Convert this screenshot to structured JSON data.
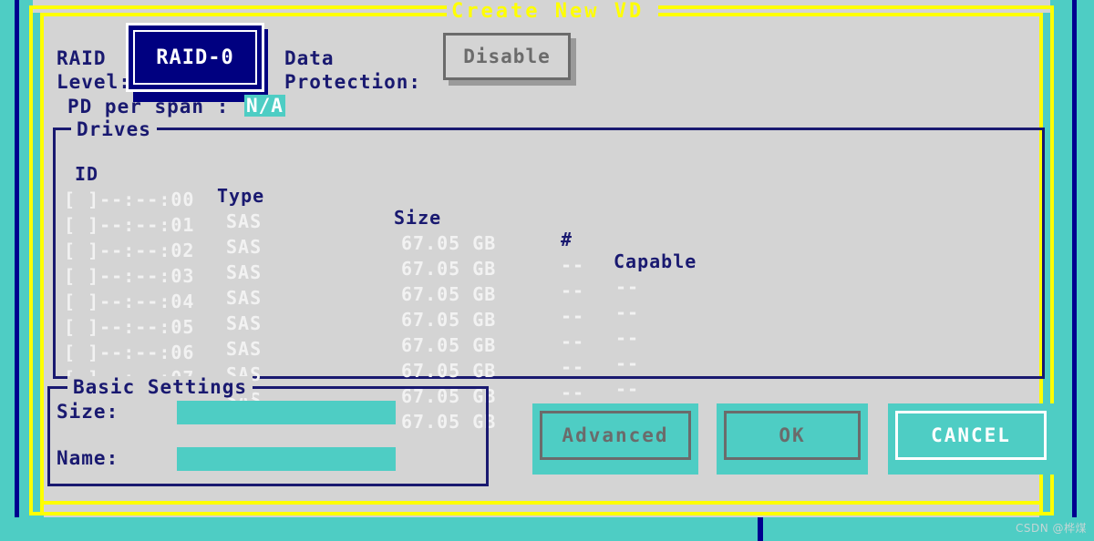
{
  "window": {
    "title": "Create New VD",
    "title_color": "#ffff00",
    "frame_color": "#00008f",
    "surface_color": "#d4d4d4",
    "accent_teal": "#4ecdc4",
    "navy_text_color": "#191970"
  },
  "raid": {
    "label_line1": "RAID",
    "label_line2": "Level:",
    "selected_level": "RAID-0",
    "pd_per_span_label": "PD per span :",
    "pd_per_span_value": "N/A"
  },
  "data_protection": {
    "label_line1": "Data",
    "label_line2": "Protection:",
    "value": "Disable"
  },
  "drives": {
    "legend": "Drives",
    "columns": [
      "ID",
      "Type",
      "Size",
      "#",
      "Capable"
    ],
    "rows": [
      {
        "id": "[ ]--:--:00",
        "type": "SAS",
        "size": "67.05 GB",
        "num": "--",
        "capable": "--"
      },
      {
        "id": "[ ]--:--:01",
        "type": "SAS",
        "size": "67.05 GB",
        "num": "--",
        "capable": "--"
      },
      {
        "id": "[ ]--:--:02",
        "type": "SAS",
        "size": "67.05 GB",
        "num": "--",
        "capable": "--"
      },
      {
        "id": "[ ]--:--:03",
        "type": "SAS",
        "size": "67.05 GB",
        "num": "--",
        "capable": "--"
      },
      {
        "id": "[ ]--:--:04",
        "type": "SAS",
        "size": "67.05 GB",
        "num": "--",
        "capable": "--"
      },
      {
        "id": "[ ]--:--:05",
        "type": "SAS",
        "size": "67.05 GB",
        "num": "--",
        "capable": "--"
      },
      {
        "id": "[ ]--:--:06",
        "type": "SAS",
        "size": "67.05 GB",
        "num": "--",
        "capable": "--"
      },
      {
        "id": "[ ]--:--:07",
        "type": "SAS",
        "size": "67.05 GB",
        "num": "--",
        "capable": "--"
      }
    ]
  },
  "basic_settings": {
    "legend": "Basic Settings",
    "size_label": "Size:",
    "size_value": "",
    "size_placeholder": "",
    "name_label": "Name:",
    "name_value": "",
    "name_placeholder": ""
  },
  "buttons": {
    "advanced": "Advanced",
    "ok": "OK",
    "cancel": "CANCEL"
  },
  "watermark": "CSDN @桦煤"
}
